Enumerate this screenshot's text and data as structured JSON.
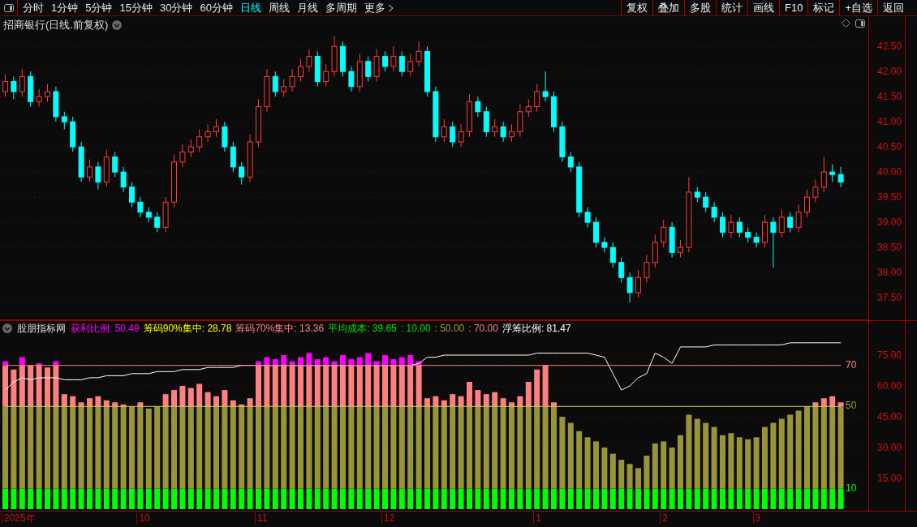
{
  "toolbar": {
    "periods": [
      {
        "label": "分时",
        "selected": false
      },
      {
        "label": "1分钟",
        "selected": false
      },
      {
        "label": "5分钟",
        "selected": false
      },
      {
        "label": "15分钟",
        "selected": false
      },
      {
        "label": "30分钟",
        "selected": false
      },
      {
        "label": "60分钟",
        "selected": false
      },
      {
        "label": "日线",
        "selected": true
      },
      {
        "label": "周线",
        "selected": false
      },
      {
        "label": "月线",
        "selected": false
      },
      {
        "label": "多周期",
        "selected": false
      }
    ],
    "more": "更多",
    "actions": [
      "复权",
      "叠加",
      "多股",
      "统计",
      "画线",
      "F10",
      "标记",
      "+自选",
      "返回"
    ]
  },
  "chart": {
    "title": "招商银行(日线.前复权)",
    "chart_data": {
      "type": "candlestick",
      "grid": true,
      "ylim": [
        37.05,
        43.1
      ],
      "ohlc": [
        [
          41.6,
          41.95,
          41.5,
          41.8
        ],
        [
          41.8,
          41.9,
          41.45,
          41.6
        ],
        [
          41.6,
          42.05,
          41.5,
          41.9
        ],
        [
          41.9,
          42.0,
          41.3,
          41.4
        ],
        [
          41.4,
          41.65,
          41.3,
          41.5
        ],
        [
          41.5,
          41.75,
          41.4,
          41.6
        ],
        [
          41.6,
          41.7,
          41.0,
          41.1
        ],
        [
          41.1,
          41.2,
          40.85,
          41.0
        ],
        [
          41.0,
          41.1,
          40.4,
          40.5
        ],
        [
          40.5,
          40.6,
          39.8,
          39.9
        ],
        [
          39.9,
          40.25,
          39.8,
          40.1
        ],
        [
          40.1,
          40.2,
          39.65,
          39.8
        ],
        [
          39.8,
          40.45,
          39.7,
          40.3
        ],
        [
          40.3,
          40.4,
          39.9,
          40.0
        ],
        [
          40.0,
          40.1,
          39.6,
          39.7
        ],
        [
          39.7,
          39.8,
          39.3,
          39.4
        ],
        [
          39.4,
          39.5,
          39.1,
          39.2
        ],
        [
          39.2,
          39.3,
          39.0,
          39.1
        ],
        [
          39.1,
          39.2,
          38.8,
          38.9
        ],
        [
          38.9,
          39.5,
          38.8,
          39.4
        ],
        [
          39.4,
          40.35,
          39.3,
          40.2
        ],
        [
          40.2,
          40.55,
          40.1,
          40.4
        ],
        [
          40.4,
          40.65,
          40.3,
          40.5
        ],
        [
          40.5,
          40.85,
          40.4,
          40.7
        ],
        [
          40.7,
          40.95,
          40.6,
          40.8
        ],
        [
          40.8,
          41.05,
          40.7,
          40.9
        ],
        [
          40.9,
          41.0,
          40.4,
          40.5
        ],
        [
          40.5,
          40.6,
          40.0,
          40.1
        ],
        [
          40.1,
          40.2,
          39.75,
          39.9
        ],
        [
          39.9,
          40.75,
          39.8,
          40.6
        ],
        [
          40.6,
          41.45,
          40.5,
          41.3
        ],
        [
          41.3,
          42.05,
          41.2,
          41.9
        ],
        [
          41.9,
          42.0,
          41.5,
          41.6
        ],
        [
          41.6,
          41.85,
          41.5,
          41.7
        ],
        [
          41.7,
          42.05,
          41.6,
          41.9
        ],
        [
          41.9,
          42.25,
          41.8,
          42.1
        ],
        [
          42.1,
          42.45,
          42.0,
          42.3
        ],
        [
          42.3,
          42.4,
          41.7,
          41.8
        ],
        [
          41.8,
          42.15,
          41.7,
          42.0
        ],
        [
          42.0,
          42.7,
          41.9,
          42.5
        ],
        [
          42.5,
          42.6,
          41.9,
          42.0
        ],
        [
          42.0,
          42.1,
          41.6,
          41.7
        ],
        [
          41.7,
          42.35,
          41.6,
          42.2
        ],
        [
          42.2,
          42.3,
          41.8,
          41.9
        ],
        [
          41.9,
          42.45,
          41.8,
          42.3
        ],
        [
          42.3,
          42.4,
          42.0,
          42.1
        ],
        [
          42.1,
          42.5,
          42.0,
          42.3
        ],
        [
          42.3,
          42.4,
          41.9,
          42.0
        ],
        [
          42.0,
          42.35,
          41.9,
          42.2
        ],
        [
          42.2,
          42.6,
          42.1,
          42.4
        ],
        [
          42.4,
          42.5,
          41.5,
          41.6
        ],
        [
          41.6,
          41.7,
          40.6,
          40.7
        ],
        [
          40.7,
          41.05,
          40.6,
          40.9
        ],
        [
          40.9,
          41.0,
          40.5,
          40.6
        ],
        [
          40.6,
          40.95,
          40.5,
          40.8
        ],
        [
          40.8,
          41.55,
          40.7,
          41.4
        ],
        [
          41.4,
          41.5,
          41.1,
          41.2
        ],
        [
          41.2,
          41.3,
          40.7,
          40.8
        ],
        [
          40.8,
          41.05,
          40.7,
          40.9
        ],
        [
          40.9,
          41.0,
          40.6,
          40.7
        ],
        [
          40.7,
          40.95,
          40.6,
          40.8
        ],
        [
          40.8,
          41.35,
          40.7,
          41.2
        ],
        [
          41.2,
          41.45,
          41.1,
          41.3
        ],
        [
          41.3,
          41.75,
          41.2,
          41.6
        ],
        [
          41.6,
          42.0,
          41.4,
          41.5
        ],
        [
          41.5,
          41.6,
          40.8,
          40.9
        ],
        [
          40.9,
          41.0,
          40.2,
          40.3
        ],
        [
          40.3,
          40.4,
          40.0,
          40.1
        ],
        [
          40.1,
          40.2,
          39.1,
          39.2
        ],
        [
          39.2,
          39.3,
          38.9,
          39.0
        ],
        [
          39.0,
          39.1,
          38.5,
          38.6
        ],
        [
          38.6,
          38.7,
          38.4,
          38.5
        ],
        [
          38.5,
          38.6,
          38.1,
          38.2
        ],
        [
          38.2,
          38.3,
          37.8,
          37.9
        ],
        [
          37.9,
          38.0,
          37.4,
          37.6
        ],
        [
          37.6,
          38.05,
          37.5,
          37.9
        ],
        [
          37.9,
          38.35,
          37.8,
          38.2
        ],
        [
          38.2,
          38.75,
          38.1,
          38.6
        ],
        [
          38.6,
          39.05,
          38.5,
          38.9
        ],
        [
          38.9,
          39.0,
          38.3,
          38.4
        ],
        [
          38.4,
          38.65,
          38.3,
          38.5
        ],
        [
          38.5,
          39.9,
          38.4,
          39.6
        ],
        [
          39.6,
          39.7,
          39.4,
          39.5
        ],
        [
          39.5,
          39.6,
          39.2,
          39.3
        ],
        [
          39.3,
          39.4,
          39.0,
          39.1
        ],
        [
          39.1,
          39.2,
          38.7,
          38.8
        ],
        [
          38.8,
          39.15,
          38.7,
          39.0
        ],
        [
          39.0,
          39.1,
          38.7,
          38.8
        ],
        [
          38.8,
          38.9,
          38.6,
          38.7
        ],
        [
          38.7,
          38.8,
          38.5,
          38.6
        ],
        [
          38.6,
          39.15,
          38.5,
          39.0
        ],
        [
          39.0,
          39.1,
          38.1,
          38.8
        ],
        [
          38.8,
          39.25,
          38.7,
          39.1
        ],
        [
          39.1,
          39.2,
          38.8,
          38.9
        ],
        [
          38.9,
          39.35,
          38.8,
          39.2
        ],
        [
          39.2,
          39.65,
          39.1,
          39.5
        ],
        [
          39.5,
          39.85,
          39.4,
          39.7
        ],
        [
          39.7,
          40.3,
          39.6,
          40.0
        ],
        [
          40.0,
          40.15,
          39.8,
          39.95
        ],
        [
          39.95,
          40.1,
          39.7,
          39.8
        ]
      ],
      "yticks": [
        {
          "value": 42.5,
          "label": "42.50"
        },
        {
          "value": 42.0,
          "label": "42.00"
        },
        {
          "value": 41.5,
          "label": "41.50"
        },
        {
          "value": 41.0,
          "label": "41.00"
        },
        {
          "value": 40.5,
          "label": "40.50"
        },
        {
          "value": 40.0,
          "label": "40.00"
        },
        {
          "value": 39.5,
          "label": "39.50"
        },
        {
          "value": 39.0,
          "label": "39.00"
        },
        {
          "value": 38.5,
          "label": "38.50"
        },
        {
          "value": 38.0,
          "label": "38.00"
        },
        {
          "value": 37.5,
          "label": "37.50"
        }
      ]
    }
  },
  "indicator": {
    "name": "股朋指标网",
    "legend": [
      {
        "text": "获利比例: 50.49",
        "color": "#ff00ff"
      },
      {
        "text": "筹码90%集中: 28.78",
        "color": "#ffff00"
      },
      {
        "text": "筹码70%集中: 13.36",
        "color": "#ff8080"
      },
      {
        "text": "平均成本: 39.65",
        "color": "#00e000"
      },
      {
        "text": ": 10.00",
        "color": "#00e000"
      },
      {
        "text": ": 50.00",
        "color": "#a09a3a"
      },
      {
        "text": ": 70.00",
        "color": "#ff8080"
      },
      {
        "text": "浮筹比例: 81.47",
        "color": "#ffffff"
      }
    ],
    "level_labels": [
      {
        "text": "70",
        "color": "#ff8080"
      },
      {
        "text": "50",
        "color": "#a09a3a"
      },
      {
        "text": "10",
        "color": "#00ff00"
      }
    ],
    "chart_data": {
      "type": "bar",
      "stacked": true,
      "grid": true,
      "ylim": [
        -1.2,
        91.6
      ],
      "series": [
        {
          "type": "bar",
          "color": "#00ff00",
          "values": [
            10,
            10,
            10,
            10,
            10,
            10,
            10,
            10,
            10,
            10,
            10,
            10,
            10,
            10,
            10,
            10,
            10,
            10,
            10,
            10,
            10,
            10,
            10,
            10,
            10,
            10,
            10,
            10,
            10,
            10,
            10,
            10,
            10,
            10,
            10,
            10,
            10,
            10,
            10,
            10,
            10,
            10,
            10,
            10,
            10,
            10,
            10,
            10,
            10,
            10,
            10,
            10,
            10,
            10,
            10,
            10,
            10,
            10,
            10,
            10,
            10,
            10,
            10,
            10,
            10,
            10,
            10,
            10,
            10,
            10,
            10,
            10,
            10,
            10,
            10,
            10,
            10,
            10,
            10,
            10,
            10,
            10,
            10,
            10,
            10,
            10,
            10,
            10,
            10,
            10,
            10,
            10,
            10,
            10,
            10,
            10,
            10,
            10,
            10,
            10
          ]
        },
        {
          "type": "bar",
          "color": "#9a9438",
          "values": [
            40,
            40,
            40,
            40,
            40,
            40,
            40,
            40,
            40,
            40,
            40,
            40,
            40,
            40,
            40,
            40,
            40,
            39,
            40,
            40,
            40,
            40,
            40,
            40,
            40,
            40,
            40,
            40,
            40,
            40,
            40,
            40,
            40,
            40,
            40,
            40,
            40,
            40,
            40,
            40,
            40,
            40,
            40,
            40,
            40,
            40,
            40,
            40,
            40,
            40,
            40,
            40,
            40,
            40,
            40,
            40,
            40,
            40,
            40,
            40,
            40,
            40,
            40,
            40,
            40,
            40,
            35,
            32,
            28,
            25,
            23,
            20,
            17,
            14,
            12,
            10,
            16,
            22,
            23,
            20,
            26,
            36,
            34,
            32,
            30,
            26,
            27,
            25,
            24,
            25,
            30,
            32,
            34,
            36,
            38,
            40,
            40,
            40,
            40,
            40
          ]
        },
        {
          "type": "bar",
          "color": "#ff8080",
          "values": [
            20,
            18,
            20,
            20,
            20,
            19,
            20,
            6,
            5,
            2,
            4,
            5,
            3,
            2,
            1,
            0,
            2,
            0,
            0,
            6,
            8,
            10,
            9,
            11,
            7,
            5,
            8,
            3,
            1,
            4,
            20,
            20,
            20,
            20,
            20,
            20,
            20,
            20,
            20,
            20,
            20,
            20,
            20,
            20,
            20,
            20,
            20,
            20,
            20,
            20,
            4,
            5,
            3,
            6,
            5,
            12,
            8,
            6,
            7,
            4,
            2,
            5,
            12,
            18,
            20,
            2,
            0,
            0,
            0,
            0,
            0,
            0,
            0,
            0,
            0,
            0,
            0,
            0,
            0,
            0,
            0,
            0,
            0,
            0,
            0,
            0,
            0,
            0,
            0,
            0,
            0,
            0,
            0,
            0,
            0,
            0,
            2,
            4,
            5,
            2
          ]
        },
        {
          "type": "bar",
          "color": "#ff00ff",
          "values": [
            2,
            0,
            4,
            0,
            1,
            0,
            2,
            0,
            0,
            0,
            0,
            0,
            0,
            0,
            0,
            0,
            0,
            0,
            0,
            0,
            0,
            0,
            0,
            0,
            0,
            0,
            0,
            0,
            0,
            0,
            2,
            4,
            3,
            5,
            2,
            4,
            6,
            3,
            4,
            2,
            5,
            3,
            4,
            6,
            2,
            5,
            3,
            4,
            5,
            2,
            0,
            0,
            0,
            0,
            0,
            0,
            0,
            0,
            0,
            0,
            0,
            0,
            0,
            0,
            0,
            0,
            0,
            0,
            0,
            0,
            0,
            0,
            0,
            0,
            0,
            0,
            0,
            0,
            0,
            0,
            0,
            0,
            0,
            0,
            0,
            0,
            0,
            0,
            0,
            0,
            0,
            0,
            0,
            0,
            0,
            0,
            0,
            0,
            0,
            0
          ]
        },
        {
          "type": "line",
          "color": "#ffffff",
          "values": [
            58,
            62,
            64,
            63,
            64,
            64,
            64,
            63,
            63,
            63,
            64,
            64,
            65,
            65,
            65,
            66,
            66,
            66,
            67,
            67,
            67,
            68,
            68,
            68,
            69,
            69,
            69,
            69,
            70,
            70,
            70,
            70,
            70,
            70,
            70,
            70,
            70,
            70,
            70,
            70,
            70,
            70,
            70,
            70,
            70,
            70,
            70,
            70,
            70,
            71,
            74,
            74,
            75,
            75,
            75,
            75,
            75,
            75,
            75,
            75,
            75,
            75,
            75,
            76,
            76,
            76,
            76,
            76,
            76,
            76,
            75,
            74,
            66,
            58,
            60,
            64,
            66,
            76,
            74,
            71,
            79,
            79,
            79,
            79,
            80,
            80,
            80,
            80,
            80,
            80,
            80,
            80,
            80,
            81,
            81,
            81,
            81,
            81,
            81,
            81
          ]
        },
        {
          "type": "line",
          "color": "#ff8080",
          "values": [
            70,
            70,
            70,
            70,
            70,
            70,
            70,
            70,
            70,
            70,
            70,
            70,
            70,
            70,
            70,
            70,
            70,
            70,
            70,
            70,
            70,
            70,
            70,
            70,
            70,
            70,
            70,
            70,
            70,
            70,
            70,
            70,
            70,
            70,
            70,
            70,
            70,
            70,
            70,
            70,
            70,
            70,
            70,
            70,
            70,
            70,
            70,
            70,
            70,
            70,
            70,
            70,
            70,
            70,
            70,
            70,
            70,
            70,
            70,
            70,
            70,
            70,
            70,
            70,
            70,
            70,
            70,
            70,
            70,
            70,
            70,
            70,
            70,
            70,
            70,
            70,
            70,
            70,
            70,
            70,
            70,
            70,
            70,
            70,
            70,
            70,
            70,
            70,
            70,
            70,
            70,
            70,
            70,
            70,
            70,
            70,
            70,
            70,
            70,
            70
          ]
        },
        {
          "type": "line",
          "color": "#d8d060",
          "values": [
            50,
            50,
            50,
            50,
            50,
            50,
            50,
            50,
            50,
            50,
            50,
            50,
            50,
            50,
            50,
            50,
            50,
            50,
            50,
            50,
            50,
            50,
            50,
            50,
            50,
            50,
            50,
            50,
            50,
            50,
            50,
            50,
            50,
            50,
            50,
            50,
            50,
            50,
            50,
            50,
            50,
            50,
            50,
            50,
            50,
            50,
            50,
            50,
            50,
            50,
            50,
            50,
            50,
            50,
            50,
            50,
            50,
            50,
            50,
            50,
            50,
            50,
            50,
            50,
            50,
            50,
            50,
            50,
            50,
            50,
            50,
            50,
            50,
            50,
            50,
            50,
            50,
            50,
            50,
            50,
            50,
            50,
            50,
            50,
            50,
            50,
            50,
            50,
            50,
            50,
            50,
            50,
            50,
            50,
            50,
            50,
            50,
            50,
            50,
            50
          ]
        }
      ],
      "yticks": [
        {
          "value": 75,
          "label": "75.00"
        },
        {
          "value": 60,
          "label": "60.00"
        },
        {
          "value": 45,
          "label": "45.00"
        },
        {
          "value": 30,
          "label": "30.00"
        },
        {
          "value": 15,
          "label": "15.00"
        }
      ]
    }
  },
  "date_axis": [
    "2025年",
    "10",
    "11",
    "12",
    "1",
    "2",
    "3"
  ]
}
